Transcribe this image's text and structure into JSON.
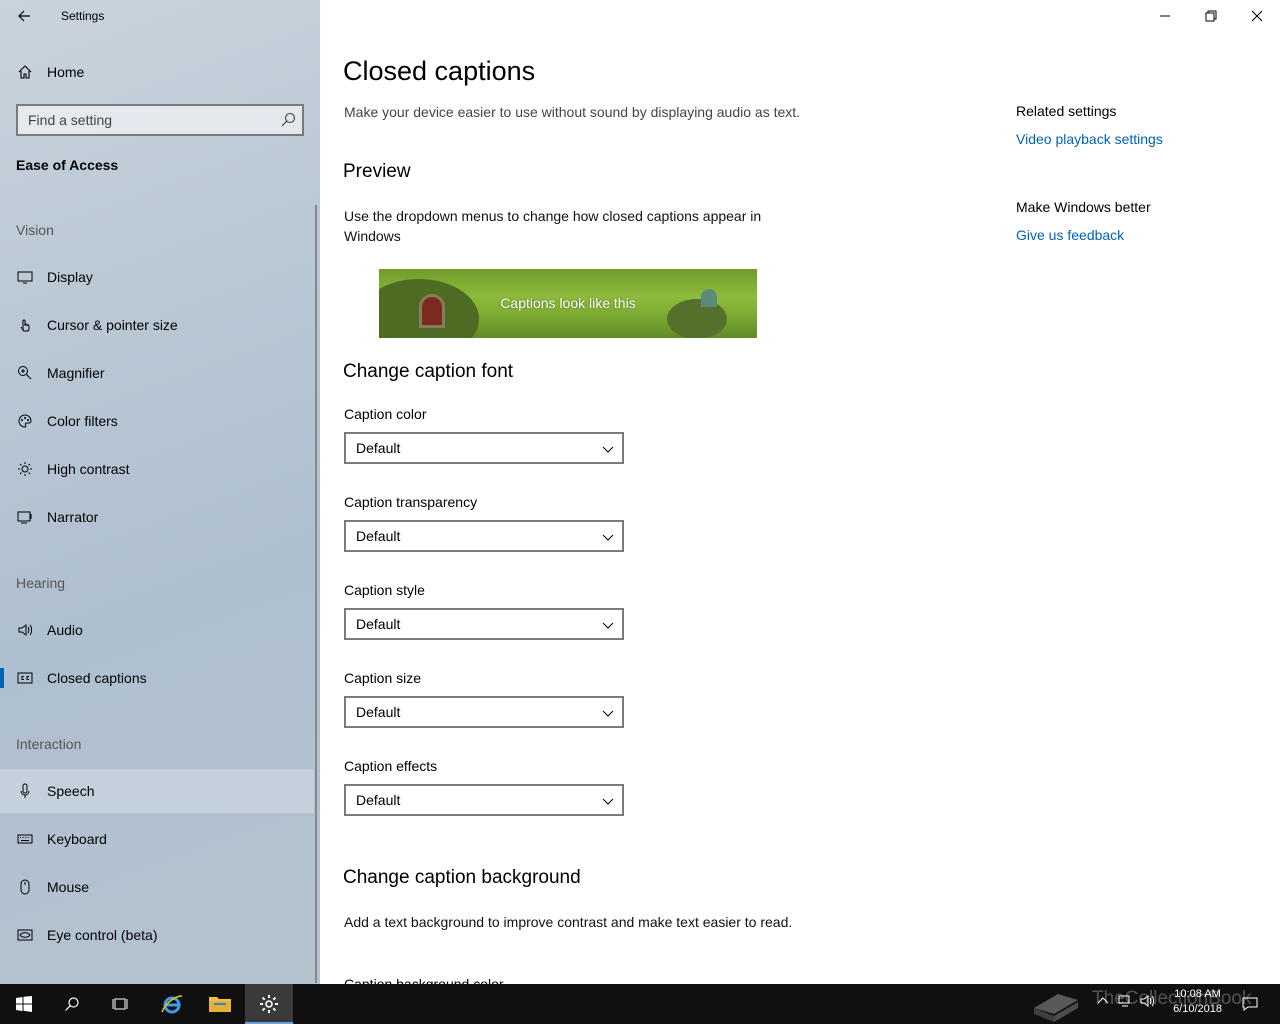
{
  "window": {
    "app_title": "Settings"
  },
  "sidebar": {
    "home_label": "Home",
    "search_placeholder": "Find a setting",
    "section_title": "Ease of Access",
    "groups": {
      "vision": "Vision",
      "hearing": "Hearing",
      "interaction": "Interaction"
    },
    "items": {
      "display": "Display",
      "cursor": "Cursor & pointer size",
      "magnifier": "Magnifier",
      "color_filters": "Color filters",
      "high_contrast": "High contrast",
      "narrator": "Narrator",
      "audio": "Audio",
      "closed_captions": "Closed captions",
      "speech": "Speech",
      "keyboard": "Keyboard",
      "mouse": "Mouse",
      "eye_control": "Eye control (beta)"
    },
    "selected": "Closed captions"
  },
  "main": {
    "title": "Closed captions",
    "intro": "Make your device easier to use without sound by displaying audio as text.",
    "preview_heading": "Preview",
    "preview_desc": "Use the dropdown menus to change how closed captions appear in Windows",
    "preview_caption": "Captions look like this",
    "font_heading": "Change caption font",
    "fields": {
      "color": {
        "label": "Caption color",
        "value": "Default"
      },
      "transparency": {
        "label": "Caption transparency",
        "value": "Default"
      },
      "style": {
        "label": "Caption style",
        "value": "Default"
      },
      "size": {
        "label": "Caption size",
        "value": "Default"
      },
      "effects": {
        "label": "Caption effects",
        "value": "Default"
      }
    },
    "background_heading": "Change caption background",
    "background_desc": "Add a text background to improve contrast and make text easier to read.",
    "next_field_partial": "Caption background color"
  },
  "related": {
    "heading": "Related settings",
    "link": "Video playback settings",
    "feedback_heading": "Make Windows better",
    "feedback_link": "Give us feedback"
  },
  "taskbar": {
    "time": "10:08 AM",
    "date": "6/10/2018",
    "watermark": "TheCollectionBook"
  },
  "colors": {
    "accent": "#0063b1",
    "taskbar": "#101010"
  }
}
